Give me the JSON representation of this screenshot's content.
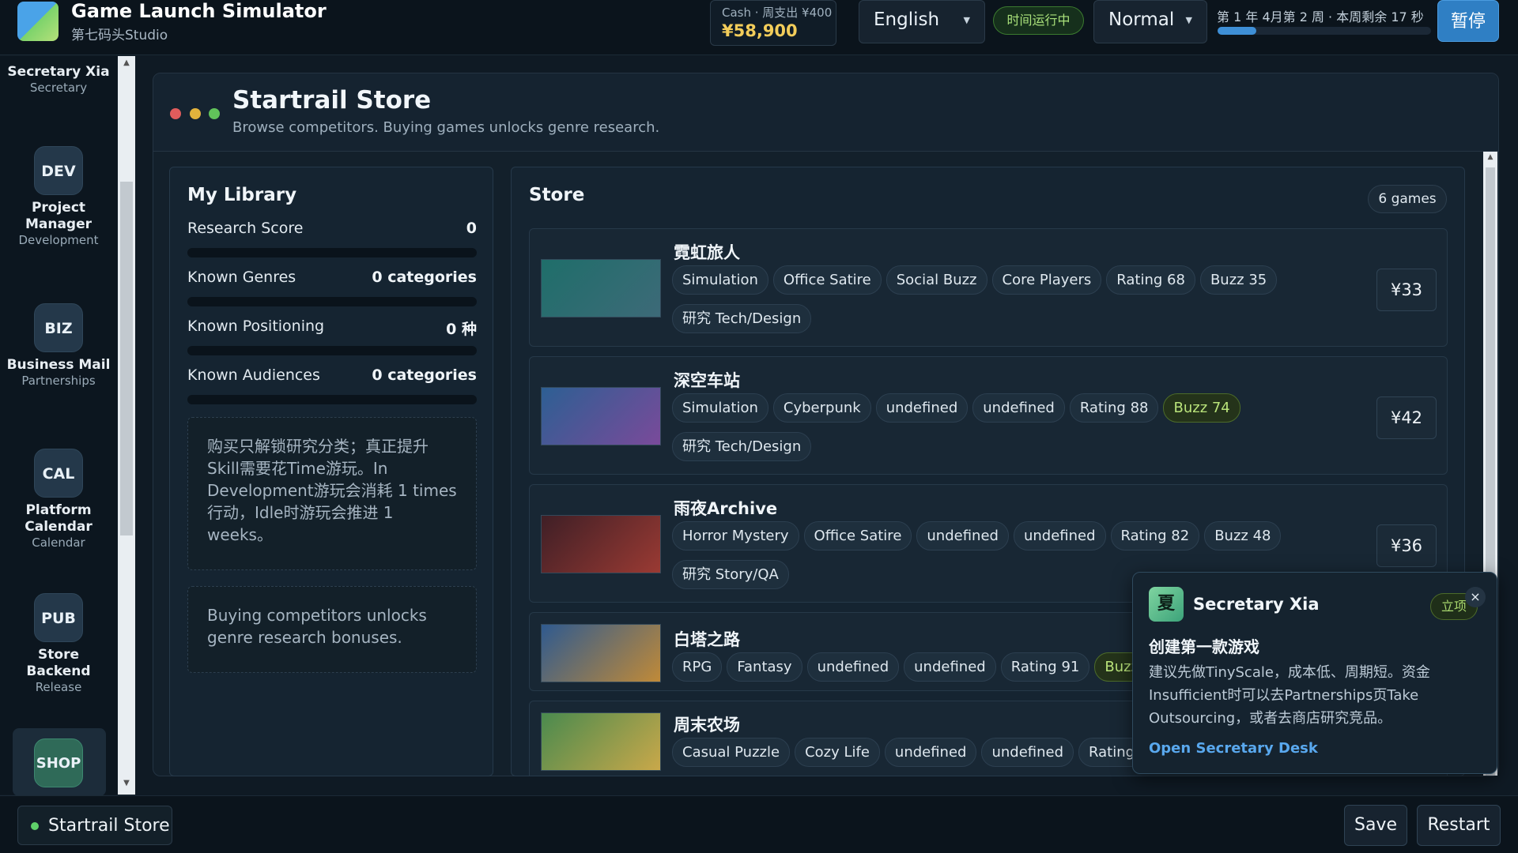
{
  "app": {
    "title": "Game Launch Simulator",
    "studio": "第七码头Studio"
  },
  "topbar": {
    "cash_label": "Cash · 周支出 ¥400",
    "cash_value": "¥58,900",
    "language": "English",
    "running_status": "时间运行中",
    "speed": "Normal",
    "week_info": "第 1 年 4月第 2 周 · 本周剩余 17 秒",
    "week_progress": 0.18,
    "pause_label": "暂停"
  },
  "sidebar": {
    "items": [
      {
        "badge": "",
        "name": "Secretary Xia",
        "role": "Secretary"
      },
      {
        "badge": "DEV",
        "name": "Project Manager",
        "role": "Development"
      },
      {
        "badge": "BIZ",
        "name": "Business Mail",
        "role": "Partnerships"
      },
      {
        "badge": "CAL",
        "name": "Platform Calendar",
        "role": "Calendar"
      },
      {
        "badge": "PUB",
        "name": "Store Backend",
        "role": "Release"
      },
      {
        "badge": "SHOP",
        "name": "",
        "role": ""
      }
    ]
  },
  "panel": {
    "title": "Startrail Store",
    "subtitle": "Browse competitors. Buying games unlocks genre research."
  },
  "library": {
    "title": "My Library",
    "stats": [
      {
        "label": "Research Score",
        "value": "0"
      },
      {
        "label": "Known Genres",
        "value": "0 categories"
      },
      {
        "label": "Known Positioning",
        "value": "0 种"
      },
      {
        "label": "Known Audiences",
        "value": "0 categories"
      }
    ],
    "note1": "购买只解锁研究分类；真正提升Skill需要花Time游玩。In Development游玩会消耗 1 times行动，Idle时游玩会推进 1 weeks。",
    "note2": "Buying competitors unlocks genre research bonuses."
  },
  "store": {
    "title": "Store",
    "count": "6 games",
    "games": [
      {
        "name": "霓虹旅人",
        "tags": [
          "Simulation",
          "Office Satire",
          "Social Buzz",
          "Core Players",
          "Rating 68",
          "Buzz 35",
          "研究 Tech/Design"
        ],
        "price": "¥33",
        "colors": [
          "#1f6e6a",
          "#3d6a78"
        ]
      },
      {
        "name": "深空车站",
        "tags": [
          "Simulation",
          "Cyberpunk",
          "undefined",
          "undefined",
          "Rating 88",
          "Buzz 74",
          "研究 Tech/Design"
        ],
        "price": "¥42",
        "colors": [
          "#2d5f93",
          "#7a4a9a"
        ]
      },
      {
        "name": "雨夜Archive",
        "tags": [
          "Horror Mystery",
          "Office Satire",
          "undefined",
          "undefined",
          "Rating 82",
          "Buzz 48",
          "研究 Story/QA"
        ],
        "price": "¥36",
        "colors": [
          "#3f1f26",
          "#9a3a33"
        ]
      },
      {
        "name": "白塔之路",
        "tags": [
          "RPG",
          "Fantasy",
          "undefined",
          "undefined",
          "Rating 91",
          "Buzz"
        ],
        "price": "",
        "colors": [
          "#2f5a8f",
          "#c08a38"
        ]
      },
      {
        "name": "周末农场",
        "tags": [
          "Casual Puzzle",
          "Cozy Life",
          "undefined",
          "undefined",
          "Rating"
        ],
        "price": "",
        "colors": [
          "#4a8a4e",
          "#c9a84a"
        ]
      }
    ]
  },
  "popup": {
    "avatar": "夏",
    "name": "Secretary Xia",
    "tag": "立项",
    "close": "×",
    "heading": "创建第一款游戏",
    "body": "建议先做TinyScale，成本低、周期短。资金Insufficient时可以去Partnerships页Take Outsourcing，或者去商店研究竞品。",
    "link": "Open Secretary Desk"
  },
  "bottombar": {
    "current_route": "Startrail Store",
    "save_label": "Save",
    "restart_label": "Restart"
  }
}
